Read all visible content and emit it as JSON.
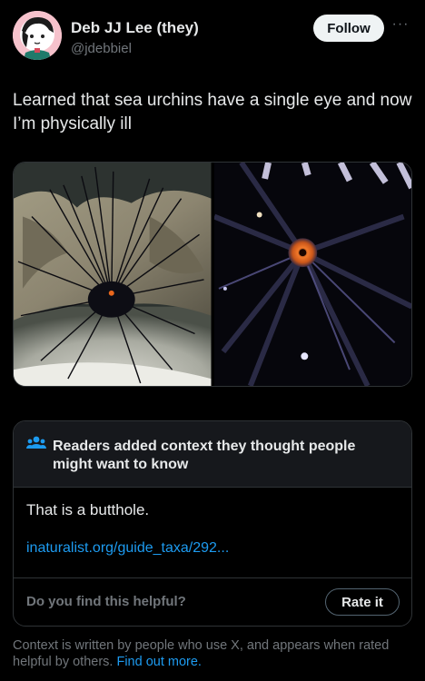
{
  "author": {
    "display_name": "Deb JJ Lee (they)",
    "handle": "@jdebbiel",
    "avatar_icon": "avatar-illustration"
  },
  "actions": {
    "follow_label": "Follow",
    "more_label": "···"
  },
  "tweet": {
    "text": "Learned that sea urchins have a single eye and now I’m physically ill"
  },
  "media": {
    "count": 2
  },
  "community_note": {
    "icon": "readers-icon",
    "title": "Readers added context they thought people might want to know",
    "body": "That is a butthole.",
    "link_text": "inaturalist.org/guide_taxa/292...",
    "helpful_question": "Do you find this helpful?",
    "rate_label": "Rate it"
  },
  "footer": {
    "text": "Context is written by people who use X, and appears when rated helpful by others.",
    "link_text": "Find out more."
  },
  "colors": {
    "background": "#000000",
    "accent": "#1d9bf0",
    "muted": "#71767b",
    "border": "#2f3336"
  }
}
